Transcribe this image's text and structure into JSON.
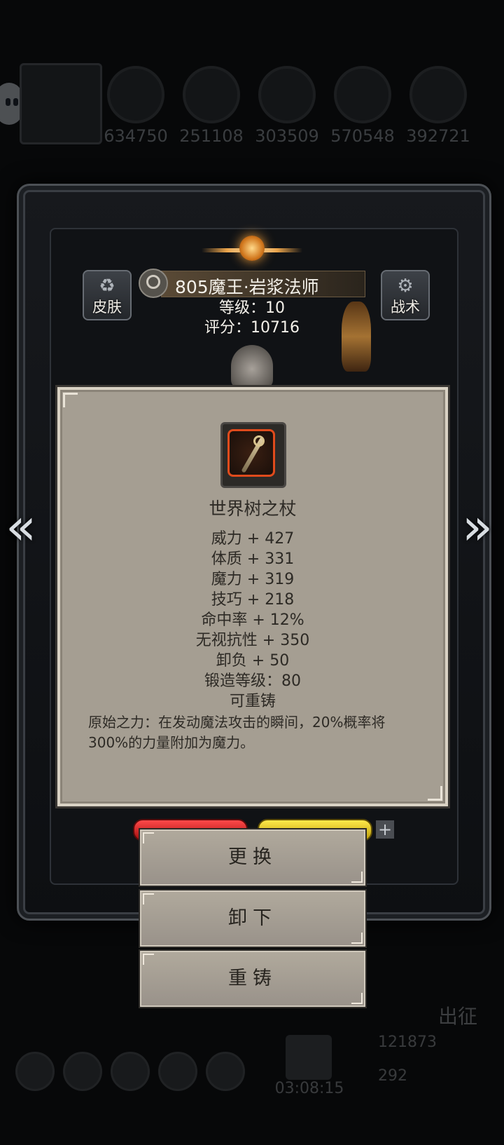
{
  "resources": {
    "items": [
      {
        "icon": "fire-resource-icon",
        "value": "634750"
      },
      {
        "icon": "bread-resource-icon",
        "value": "251108"
      },
      {
        "icon": "stone-resource-icon",
        "value": "303509"
      },
      {
        "icon": "crystal-resource-icon",
        "value": "570548"
      },
      {
        "icon": "iron-resource-icon",
        "value": "392721"
      }
    ]
  },
  "hero": {
    "name": "805魔王·岩浆法师",
    "level": "等级：10",
    "score": "评分：10716"
  },
  "buttons": {
    "skin": "皮肤",
    "tactic": "战术",
    "replace": "更换",
    "unequip": "卸下",
    "reforge": "重铸"
  },
  "item": {
    "name": "世界树之杖",
    "stats": [
      "威力 + 427",
      "体质 + 331",
      "魔力 + 319",
      "技巧 + 218",
      "命中率 + 12%",
      "无视抗性 + 350",
      "卸负 + 50",
      "锻造等级：80",
      "可重铸"
    ],
    "description": "原始之力：在发动魔法攻击的瞬间，20%概率将300%的力量附加为魔力。"
  },
  "bottom": {
    "timer": "03:08:15",
    "gold": "121873",
    "gems": "292",
    "depart": "出征"
  },
  "colors": {
    "panel": "#a59e92",
    "item_border": "#e04b1c",
    "hp_bar": "#e02020",
    "energy_bar": "#e8cf1a"
  }
}
